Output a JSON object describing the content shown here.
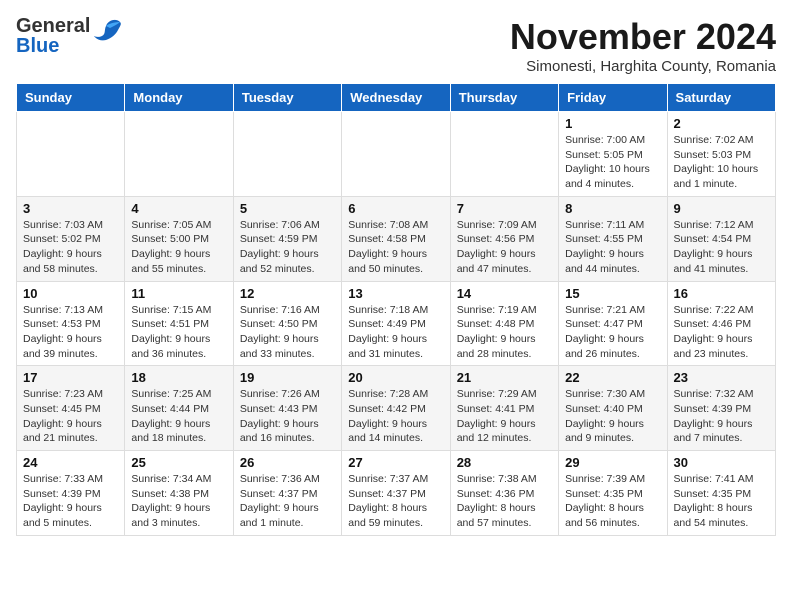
{
  "header": {
    "logo_general": "General",
    "logo_blue": "Blue",
    "month_title": "November 2024",
    "subtitle": "Simonesti, Harghita County, Romania"
  },
  "weekdays": [
    "Sunday",
    "Monday",
    "Tuesday",
    "Wednesday",
    "Thursday",
    "Friday",
    "Saturday"
  ],
  "weeks": [
    [
      {
        "day": "",
        "info": ""
      },
      {
        "day": "",
        "info": ""
      },
      {
        "day": "",
        "info": ""
      },
      {
        "day": "",
        "info": ""
      },
      {
        "day": "",
        "info": ""
      },
      {
        "day": "1",
        "info": "Sunrise: 7:00 AM\nSunset: 5:05 PM\nDaylight: 10 hours and 4 minutes."
      },
      {
        "day": "2",
        "info": "Sunrise: 7:02 AM\nSunset: 5:03 PM\nDaylight: 10 hours and 1 minute."
      }
    ],
    [
      {
        "day": "3",
        "info": "Sunrise: 7:03 AM\nSunset: 5:02 PM\nDaylight: 9 hours and 58 minutes."
      },
      {
        "day": "4",
        "info": "Sunrise: 7:05 AM\nSunset: 5:00 PM\nDaylight: 9 hours and 55 minutes."
      },
      {
        "day": "5",
        "info": "Sunrise: 7:06 AM\nSunset: 4:59 PM\nDaylight: 9 hours and 52 minutes."
      },
      {
        "day": "6",
        "info": "Sunrise: 7:08 AM\nSunset: 4:58 PM\nDaylight: 9 hours and 50 minutes."
      },
      {
        "day": "7",
        "info": "Sunrise: 7:09 AM\nSunset: 4:56 PM\nDaylight: 9 hours and 47 minutes."
      },
      {
        "day": "8",
        "info": "Sunrise: 7:11 AM\nSunset: 4:55 PM\nDaylight: 9 hours and 44 minutes."
      },
      {
        "day": "9",
        "info": "Sunrise: 7:12 AM\nSunset: 4:54 PM\nDaylight: 9 hours and 41 minutes."
      }
    ],
    [
      {
        "day": "10",
        "info": "Sunrise: 7:13 AM\nSunset: 4:53 PM\nDaylight: 9 hours and 39 minutes."
      },
      {
        "day": "11",
        "info": "Sunrise: 7:15 AM\nSunset: 4:51 PM\nDaylight: 9 hours and 36 minutes."
      },
      {
        "day": "12",
        "info": "Sunrise: 7:16 AM\nSunset: 4:50 PM\nDaylight: 9 hours and 33 minutes."
      },
      {
        "day": "13",
        "info": "Sunrise: 7:18 AM\nSunset: 4:49 PM\nDaylight: 9 hours and 31 minutes."
      },
      {
        "day": "14",
        "info": "Sunrise: 7:19 AM\nSunset: 4:48 PM\nDaylight: 9 hours and 28 minutes."
      },
      {
        "day": "15",
        "info": "Sunrise: 7:21 AM\nSunset: 4:47 PM\nDaylight: 9 hours and 26 minutes."
      },
      {
        "day": "16",
        "info": "Sunrise: 7:22 AM\nSunset: 4:46 PM\nDaylight: 9 hours and 23 minutes."
      }
    ],
    [
      {
        "day": "17",
        "info": "Sunrise: 7:23 AM\nSunset: 4:45 PM\nDaylight: 9 hours and 21 minutes."
      },
      {
        "day": "18",
        "info": "Sunrise: 7:25 AM\nSunset: 4:44 PM\nDaylight: 9 hours and 18 minutes."
      },
      {
        "day": "19",
        "info": "Sunrise: 7:26 AM\nSunset: 4:43 PM\nDaylight: 9 hours and 16 minutes."
      },
      {
        "day": "20",
        "info": "Sunrise: 7:28 AM\nSunset: 4:42 PM\nDaylight: 9 hours and 14 minutes."
      },
      {
        "day": "21",
        "info": "Sunrise: 7:29 AM\nSunset: 4:41 PM\nDaylight: 9 hours and 12 minutes."
      },
      {
        "day": "22",
        "info": "Sunrise: 7:30 AM\nSunset: 4:40 PM\nDaylight: 9 hours and 9 minutes."
      },
      {
        "day": "23",
        "info": "Sunrise: 7:32 AM\nSunset: 4:39 PM\nDaylight: 9 hours and 7 minutes."
      }
    ],
    [
      {
        "day": "24",
        "info": "Sunrise: 7:33 AM\nSunset: 4:39 PM\nDaylight: 9 hours and 5 minutes."
      },
      {
        "day": "25",
        "info": "Sunrise: 7:34 AM\nSunset: 4:38 PM\nDaylight: 9 hours and 3 minutes."
      },
      {
        "day": "26",
        "info": "Sunrise: 7:36 AM\nSunset: 4:37 PM\nDaylight: 9 hours and 1 minute."
      },
      {
        "day": "27",
        "info": "Sunrise: 7:37 AM\nSunset: 4:37 PM\nDaylight: 8 hours and 59 minutes."
      },
      {
        "day": "28",
        "info": "Sunrise: 7:38 AM\nSunset: 4:36 PM\nDaylight: 8 hours and 57 minutes."
      },
      {
        "day": "29",
        "info": "Sunrise: 7:39 AM\nSunset: 4:35 PM\nDaylight: 8 hours and 56 minutes."
      },
      {
        "day": "30",
        "info": "Sunrise: 7:41 AM\nSunset: 4:35 PM\nDaylight: 8 hours and 54 minutes."
      }
    ]
  ]
}
